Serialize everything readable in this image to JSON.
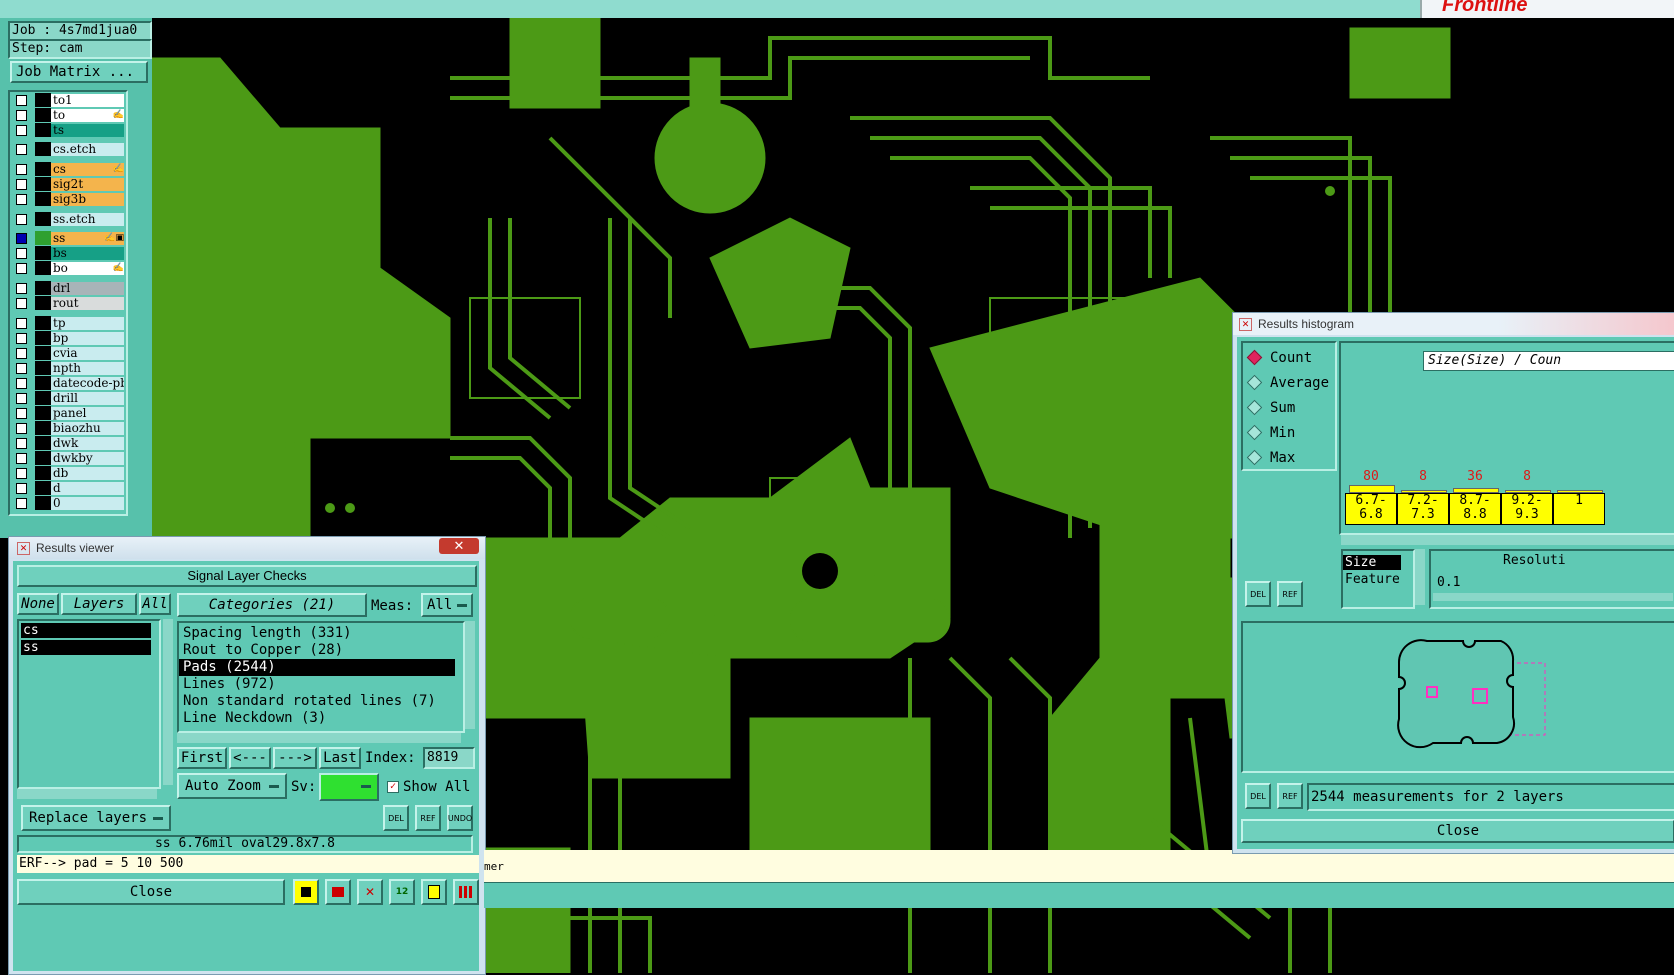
{
  "job": {
    "job_label": "Job : 4s7md1jua0",
    "step_label": "Step: cam",
    "matrix_button": "Job Matrix ..."
  },
  "layers": [
    {
      "name": "to1",
      "color": "#ffffff"
    },
    {
      "name": "to",
      "color": "#ffffff",
      "flag": "✍"
    },
    {
      "name": "ts",
      "color": "#16a086"
    },
    {
      "name": "cs.etch",
      "color": "#c9ecef"
    },
    {
      "name": "cs",
      "color": "#f4b44c",
      "flag": "✍"
    },
    {
      "name": "sig2t",
      "color": "#f4b44c"
    },
    {
      "name": "sig3b",
      "color": "#f4b44c"
    },
    {
      "name": "ss.etch",
      "color": "#c9ecef"
    },
    {
      "name": "ss",
      "color": "#f4b44c",
      "flag": "✍▣"
    },
    {
      "name": "bs",
      "color": "#16a086"
    },
    {
      "name": "bo",
      "color": "#ffffff",
      "flag": "✍"
    },
    {
      "name": "drl",
      "color": "#a8b4b8"
    },
    {
      "name": "rout",
      "color": "#d9dcdc"
    },
    {
      "name": "tp",
      "color": "#c9ecef"
    },
    {
      "name": "bp",
      "color": "#c9ecef"
    },
    {
      "name": "cvia",
      "color": "#c9ecef"
    },
    {
      "name": "npth",
      "color": "#c9ecef"
    },
    {
      "name": "datecode-pbe",
      "color": "#c9ecef"
    },
    {
      "name": "drill",
      "color": "#c9ecef"
    },
    {
      "name": "panel",
      "color": "#c9ecef"
    },
    {
      "name": "biaozhu",
      "color": "#c9ecef"
    },
    {
      "name": "dwk",
      "color": "#c9ecef"
    },
    {
      "name": "dwkby",
      "color": "#c9ecef"
    },
    {
      "name": "db",
      "color": "#c9ecef"
    },
    {
      "name": "d",
      "color": "#c9ecef"
    },
    {
      "name": "0",
      "color": "#c9ecef"
    }
  ],
  "results_viewer": {
    "title": "Results viewer",
    "close_x": "✕",
    "header": "Signal Layer Checks",
    "none_btn": "None",
    "layers_btn": "Layers",
    "all_btn": "All",
    "categories_btn": "Categories (21)",
    "meas_label": "Meas:",
    "meas_value": "All",
    "layer_list": [
      "cs",
      "ss"
    ],
    "categories": [
      "Spacing length (331)",
      "Rout to Copper (28)",
      "Pads (2544)",
      "Lines (972)",
      "Non standard rotated lines (7)",
      "Line Neckdown (3)"
    ],
    "selected_category": "Pads (2544)",
    "first_btn": "First",
    "prev_btn": "<---",
    "next_btn": "--->",
    "last_btn": "Last",
    "index_label": "Index:",
    "index_value": "8819",
    "auto_zoom": "Auto Zoom",
    "sv_label": "Sv:",
    "show_all": "Show All",
    "replace_layers": "Replace layers",
    "del_icon": "DEL",
    "ref_icon": "REF",
    "undo_icon": "UNDO",
    "measure_text": "ss 6.76mil  oval29.8x7.8",
    "erf_text": "ERF--> pad = 5 10 500",
    "close_btn": "Close"
  },
  "status_partial": "mer",
  "histogram": {
    "title": "Results histogram",
    "radios": [
      {
        "label": "Count",
        "selected": true
      },
      {
        "label": "Average"
      },
      {
        "label": "Sum"
      },
      {
        "label": "Min"
      },
      {
        "label": "Max"
      }
    ],
    "chart_title": "Size(Size) / Coun",
    "bins": [
      {
        "range": "6.7-\n6.8",
        "count": "80"
      },
      {
        "range": "7.2-\n7.3",
        "count": "8"
      },
      {
        "range": "8.7-\n8.8",
        "count": "36"
      },
      {
        "range": "9.2-\n9.3",
        "count": "8"
      },
      {
        "range": "1",
        "count": ""
      }
    ],
    "size_item": "Size",
    "feature_item": "Feature",
    "resolution_label": "Resoluti",
    "resolution_value": "0.1",
    "del_icon": "DEL",
    "ref_icon": "REF",
    "measurements_text": "2544 measurements for 2 layers",
    "close_btn": "Close"
  },
  "top_right_logo": "Frontline"
}
